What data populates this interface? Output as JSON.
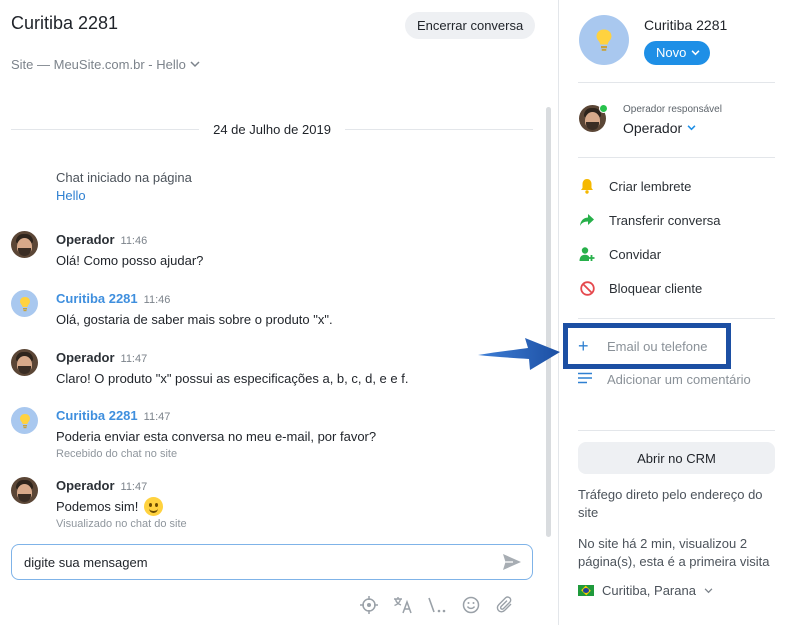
{
  "chat": {
    "title": "Curitiba 2281",
    "end_button": "Encerrar conversa",
    "subtitle": "Site — MeuSite.com.br - Hello",
    "date_separator": "24 de Julho de 2019",
    "system": {
      "text": "Chat iniciado na página",
      "link": "Hello"
    },
    "messages": [
      {
        "author": "Operador",
        "time": "11:46",
        "text": "Olá! Como posso ajudar?",
        "kind": "operator",
        "meta": ""
      },
      {
        "author": "Curitiba 2281",
        "time": "11:46",
        "text": "Olá, gostaria de saber mais sobre o produto \"x\".",
        "kind": "client",
        "meta": ""
      },
      {
        "author": "Operador",
        "time": "11:47",
        "text": "Claro! O produto \"x\" possui as especificações a, b, c, d, e e f.",
        "kind": "operator",
        "meta": ""
      },
      {
        "author": "Curitiba 2281",
        "time": "11:47",
        "text": "Poderia enviar esta conversa no meu e-mail, por favor?",
        "kind": "client",
        "meta": "Recebido do chat no site"
      },
      {
        "author": "Operador",
        "time": "11:47",
        "text": "Podemos sim!",
        "kind": "operator",
        "meta": "Visualizado no chat do site",
        "emoji": "slightly-smiling-face"
      }
    ],
    "composer_placeholder": "digite sua mensagem",
    "toolbar_icons": [
      "target-icon",
      "translate-icon",
      "shortcut-icon",
      "emoji-icon",
      "attach-icon"
    ]
  },
  "sidebar": {
    "contact_name": "Curitiba 2281",
    "status": "Novo",
    "operator_label": "Operador responsável",
    "operator_name": "Operador",
    "actions": [
      {
        "label": "Criar lembrete",
        "icon": "bell-icon",
        "color": "#f5b800"
      },
      {
        "label": "Transferir conversa",
        "icon": "share-arrow-icon",
        "color": "#27b04a"
      },
      {
        "label": "Convidar",
        "icon": "add-user-icon",
        "color": "#27b04a"
      },
      {
        "label": "Bloquear cliente",
        "icon": "block-icon",
        "color": "#e5484d"
      }
    ],
    "email_placeholder": "Email ou telefone",
    "comment_label": "Adicionar um comentário",
    "crm_button": "Abrir no CRM",
    "traffic": "Tráfego direto pelo endereço do site",
    "visit_info": "No site há 2 min, visualizou 2 página(s), esta é a primeira visita",
    "location": "Curitiba, Parana"
  },
  "colors": {
    "accent": "#1e8fe6",
    "client_name": "#3f8fde",
    "highlight_box": "#1c4fa3"
  }
}
